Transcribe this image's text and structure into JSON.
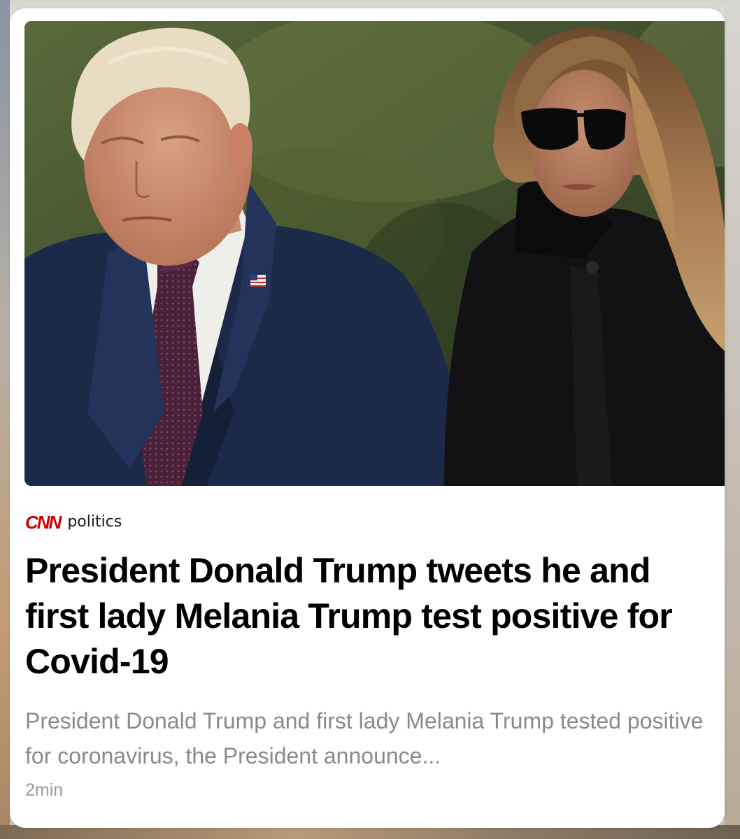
{
  "article": {
    "source_logo": "CNN",
    "section": "politics",
    "headline": "President Donald Trump tweets he and first lady Melania Trump test positive for Covid-19",
    "summary": "President Donald Trump and first lady Melania Trump tested positive for coronavirus, the President announce...",
    "read_time": "2min",
    "hero_image": "photo-of-donald-and-melania-trump"
  },
  "colors": {
    "brand_red": "#cc0000",
    "headline": "#000000",
    "summary": "#8a8a8e",
    "meta": "#9a9aa0"
  }
}
